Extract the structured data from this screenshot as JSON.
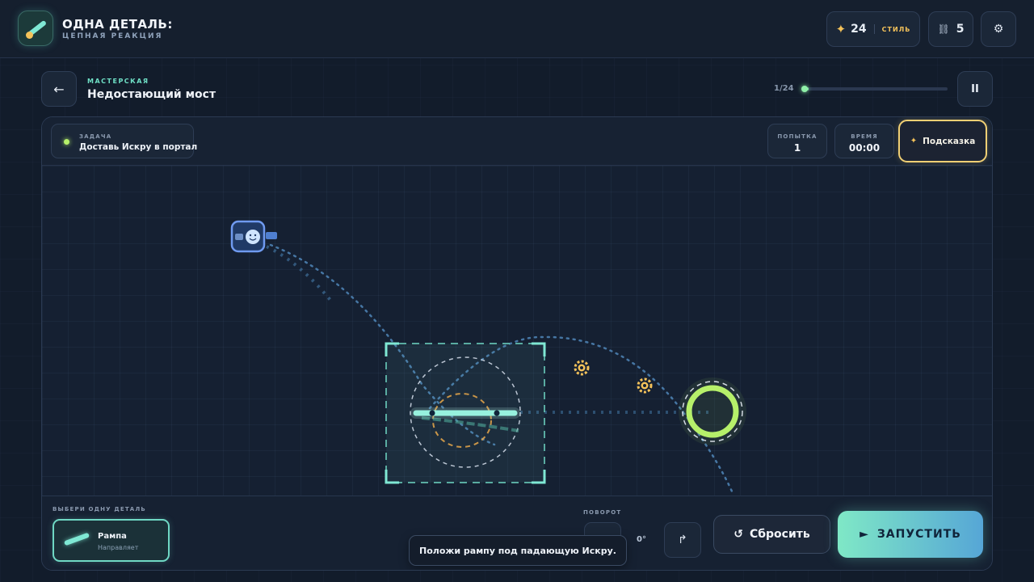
{
  "header": {
    "title": "ОДНА ДЕТАЛЬ:",
    "subtitle": "ЦЕПНАЯ РЕАКЦИЯ",
    "style_points": "24",
    "style_label": "СТИЛЬ",
    "chain_icon": "⛓",
    "chain_count": "5",
    "settings_icon": "⚙"
  },
  "level": {
    "back_icon": "←",
    "kicker": "МАСТЕРСКАЯ",
    "name": "Недостающий мост",
    "progress_text": "1/24",
    "progress_fraction": 0.0417,
    "pause_icon": "II"
  },
  "board": {
    "task_kicker": "ЗАДАЧА",
    "task_text": "Доставь Искру в портал",
    "attempt_label": "ПОПЫТКА",
    "attempt_value": "1",
    "time_label": "ВРЕМЯ",
    "time_value": "00:00",
    "hint_label": "Подсказка",
    "hint_icon": "✦"
  },
  "tray": {
    "kicker": "ВЫБЕРИ ОДНУ ДЕТАЛЬ",
    "part_name": "Рампа",
    "part_desc": "Направляет",
    "rotation_label": "ПОВОРОТ",
    "rotation_value": "0°",
    "rotate_left_icon": "↺",
    "rotate_right_icon": "↱",
    "reset_icon": "↺",
    "reset_label": "Сбросить",
    "run_icon": "►",
    "run_label": "ЗАПУСТИТЬ",
    "toast": "Положи рампу под падающую Искру."
  },
  "colors": {
    "accent_teal": "#7fe8d4",
    "accent_gold": "#f4c25a",
    "portal_green": "#b6f06a",
    "spark_blue": "#6f9af0"
  }
}
